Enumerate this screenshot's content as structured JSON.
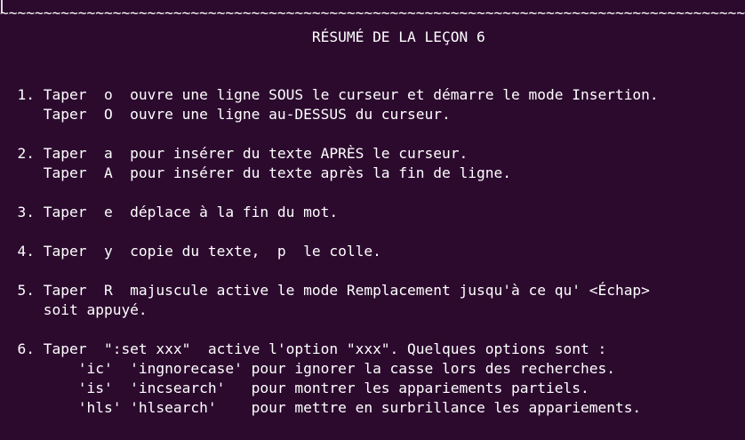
{
  "terminal": {
    "separator": "~~~~~~~~~~~~~~~~~~~~~~~~~~~~~~~~~~~~~~~~~~~~~~~~~~~~~~~~~~~~~~~~~~~~~~~~~~~~~~~~~~~~~~~~~~~~~~~~~~~~~~~~~~",
    "title": "                                    RÉSUMÉ DE LA LEÇON 6",
    "lines": [
      "  1. Taper  o  ouvre une ligne SOUS le curseur et démarre le mode Insertion.",
      "     Taper  O  ouvre une ligne au-DESSUS du curseur.",
      "",
      "  2. Taper  a  pour insérer du texte APRÈS le curseur.",
      "     Taper  A  pour insérer du texte après la fin de ligne.",
      "",
      "  3. Taper  e  déplace à la fin du mot.",
      "",
      "  4. Taper  y  copie du texte,  p  le colle.",
      "",
      "  5. Taper  R  majuscule active le mode Remplacement jusqu'à ce qu' <Échap>",
      "     soit appuyé.",
      "",
      "  6. Taper  \":set xxx\"  active l'option \"xxx\". Quelques options sont :",
      "         'ic'  'ingnorecase' pour ignorer la casse lors des recherches.",
      "         'is'  'incsearch'   pour montrer les appariements partiels.",
      "         'hls' 'hlsearch'    pour mettre en surbrillance les appariements."
    ]
  },
  "colors": {
    "background": "#2c0a2e",
    "foreground": "#ffffff"
  }
}
